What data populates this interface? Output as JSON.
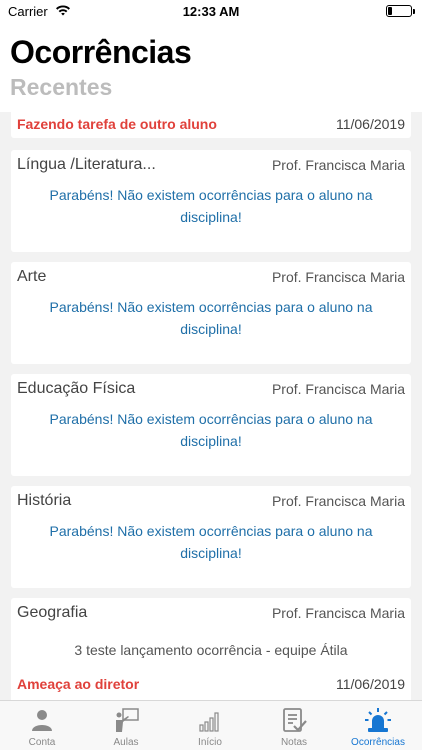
{
  "status_bar": {
    "carrier": "Carrier",
    "time": "12:33 AM"
  },
  "header": {
    "title": "Ocorrências",
    "subtitle": "Recentes"
  },
  "cards": [
    {
      "occurrences": [
        {
          "title": "Fazendo tarefa de outro aluno",
          "date": "11/06/2019"
        }
      ]
    },
    {
      "subject": "Língua /Literatura...",
      "teacher": "Prof. Francisca Maria",
      "message": "Parabéns! Não existem ocorrências para o aluno na disciplina!"
    },
    {
      "subject": "Arte",
      "teacher": "Prof. Francisca Maria",
      "message": "Parabéns! Não existem ocorrências para o aluno na disciplina!"
    },
    {
      "subject": "Educação Física",
      "teacher": "Prof. Francisca Maria",
      "message": "Parabéns! Não existem ocorrências para o aluno na disciplina!"
    },
    {
      "subject": "História",
      "teacher": "Prof. Francisca Maria",
      "message": "Parabéns! Não existem ocorrências para o aluno na disciplina!"
    },
    {
      "subject": "Geografia",
      "teacher": "Prof. Francisca Maria",
      "note": "3 teste lançamento ocorrência - equipe Átila",
      "occurrences": [
        {
          "title": "Ameaça ao diretor",
          "date": "11/06/2019"
        }
      ]
    }
  ],
  "tabbar": {
    "active": "Ocorrências",
    "active_color": "#1676d2",
    "tabs": [
      {
        "label": "Conta",
        "icon": "person-icon"
      },
      {
        "label": "Aulas",
        "icon": "teacher-board-icon"
      },
      {
        "label": "Início",
        "icon": "bar-chart-icon"
      },
      {
        "label": "Notas",
        "icon": "notes-check-icon"
      },
      {
        "label": "Ocorrências",
        "icon": "siren-icon"
      }
    ]
  },
  "colors": {
    "occurrence_title": "#e0413b",
    "message": "#1f6fa8"
  }
}
